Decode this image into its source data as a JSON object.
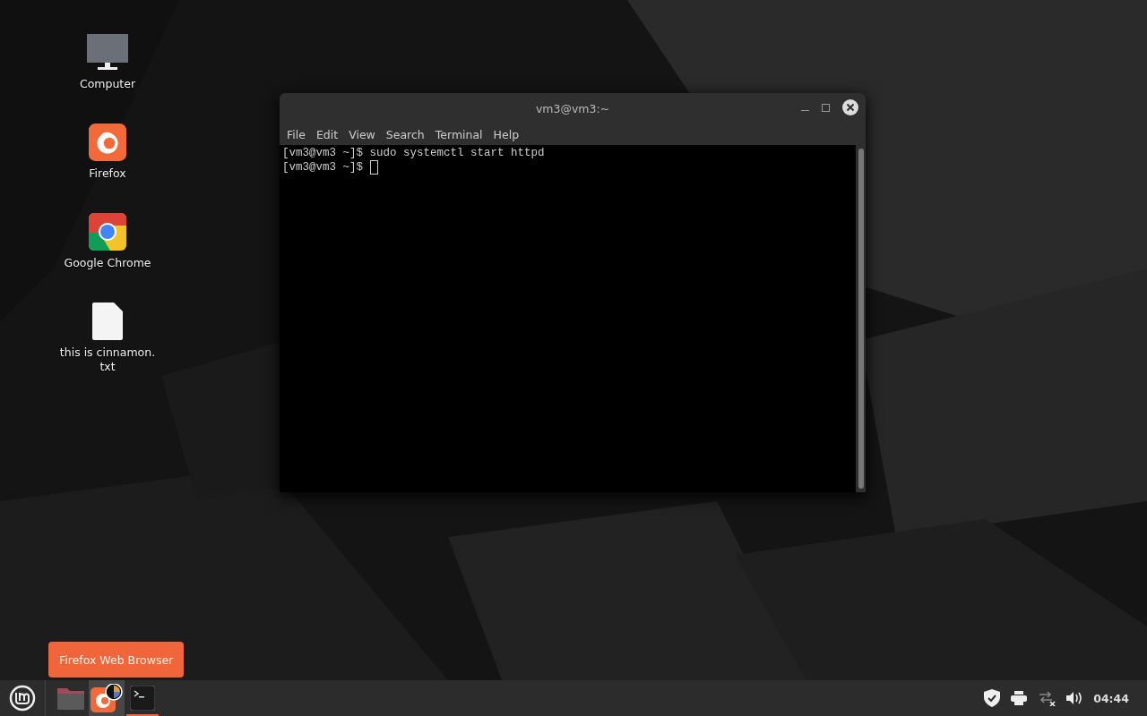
{
  "desktop_icons": [
    {
      "kind": "computer",
      "label": "Computer"
    },
    {
      "kind": "firefox",
      "label": "Firefox"
    },
    {
      "kind": "chrome",
      "label": "Google Chrome"
    },
    {
      "kind": "file",
      "label": "this is cinnamon.\ntxt"
    }
  ],
  "window": {
    "title": "vm3@vm3:~",
    "menu": [
      "File",
      "Edit",
      "View",
      "Search",
      "Terminal",
      "Help"
    ],
    "lines": [
      {
        "text": "[vm3@vm3 ~]$ sudo systemctl start httpd",
        "cursor": false
      },
      {
        "text": "[vm3@vm3 ~]$ ",
        "cursor": true
      }
    ]
  },
  "tooltip": "Firefox Web Browser",
  "taskbar": {
    "launchers": [
      {
        "kind": "files",
        "hovered": false,
        "running": false
      },
      {
        "kind": "firefox",
        "hovered": true,
        "running": false
      },
      {
        "kind": "terminal",
        "hovered": false,
        "running": true
      }
    ],
    "tray": [
      {
        "kind": "shield"
      },
      {
        "kind": "printer"
      },
      {
        "kind": "network"
      },
      {
        "kind": "volume"
      }
    ],
    "clock": "04:44"
  }
}
